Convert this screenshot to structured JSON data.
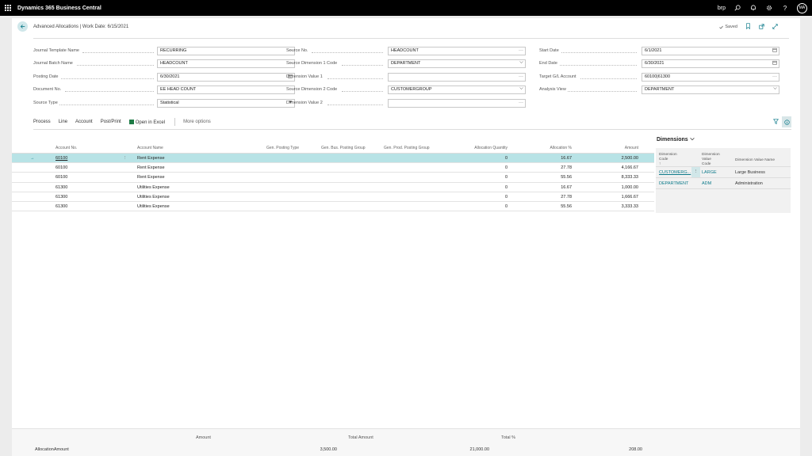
{
  "app": {
    "title": "Dynamics 365 Business Central",
    "company": "brp",
    "avatar_initials": "MA"
  },
  "page": {
    "title": "Advanced Allocations | Work Date: 6/15/2021",
    "saved_label": "Saved"
  },
  "fields": {
    "journal_template_name": {
      "label": "Journal Template Name",
      "value": "RECURRING"
    },
    "journal_batch_name": {
      "label": "Journal Batch Name",
      "value": "HEADCOUNT"
    },
    "posting_date": {
      "label": "Posting Date",
      "value": "6/30/2021"
    },
    "document_no": {
      "label": "Document No.",
      "value": "EE HEAD COUNT"
    },
    "source_type": {
      "label": "Source Type",
      "value": "Statistical"
    },
    "source_no": {
      "label": "Source No.",
      "value": "HEADCOUNT"
    },
    "source_dim1_code": {
      "label": "Source Dimension 1 Code",
      "value": "DEPARTMENT"
    },
    "dim_value1": {
      "label": "Dimension Value 1",
      "value": ""
    },
    "source_dim2_code": {
      "label": "Source Dimension 2 Code",
      "value": "CUSTOMERGROUP"
    },
    "dim_value2": {
      "label": "Dimension Value 2",
      "value": ""
    },
    "start_date": {
      "label": "Start Date",
      "value": "6/1/2021"
    },
    "end_date": {
      "label": "End Date",
      "value": "6/30/2021"
    },
    "target_gl_account": {
      "label": "Target G/L Account",
      "value": "60100|61300"
    },
    "analysis_view": {
      "label": "Analysis View",
      "value": "DEPARTMENT"
    }
  },
  "actions": {
    "process": "Process",
    "line": "Line",
    "account": "Account",
    "post_print": "Post/Print",
    "open_excel": "Open in Excel",
    "more": "More options"
  },
  "grid": {
    "headers": {
      "account_no": "Account No.",
      "account_name": "Account Name",
      "gen_posting_type": "Gen. Posting Type",
      "gen_bus_posting_group": "Gen. Bus. Posting Group",
      "gen_prod_posting_group": "Gen. Prod. Posting Group",
      "allocation_quantity": "Allocation Quantity",
      "allocation_pct": "Allocation %",
      "amount": "Amount"
    },
    "rows": [
      {
        "account_no": "60100",
        "account_name": "Rent Expense",
        "qty": "0",
        "pct": "16.67",
        "amount": "2,500.00"
      },
      {
        "account_no": "60100",
        "account_name": "Rent Expense",
        "qty": "0",
        "pct": "27.78",
        "amount": "4,166.67"
      },
      {
        "account_no": "60100",
        "account_name": "Rent Expense",
        "qty": "0",
        "pct": "55.56",
        "amount": "8,333.33"
      },
      {
        "account_no": "61300",
        "account_name": "Utilities Expense",
        "qty": "0",
        "pct": "16.67",
        "amount": "1,000.00"
      },
      {
        "account_no": "61300",
        "account_name": "Utilities Expense",
        "qty": "0",
        "pct": "27.78",
        "amount": "1,666.67"
      },
      {
        "account_no": "61300",
        "account_name": "Utilities Expense",
        "qty": "0",
        "pct": "55.56",
        "amount": "3,333.33"
      }
    ]
  },
  "factbox": {
    "title": "Dimensions",
    "headers": {
      "code_1": "Dimension",
      "code_2": "Code ↑",
      "value_code_1": "Dimension",
      "value_code_2": "Value Code",
      "value_name": "Dimension Value Name"
    },
    "rows": [
      {
        "code": "CUSTOMERG...",
        "value_code": "LARGE",
        "value_name": "Large Business"
      },
      {
        "code": "DEPARTMENT",
        "value_code": "ADM",
        "value_name": "Administration"
      }
    ]
  },
  "totals": {
    "amount_label": "Amount",
    "total_amount_label": "Total Amount",
    "total_pct_label": "Total %",
    "row_label": "AllocationAmount",
    "amount": "3,500.00",
    "total_amount": "21,000.00",
    "total_pct": "208.00"
  }
}
